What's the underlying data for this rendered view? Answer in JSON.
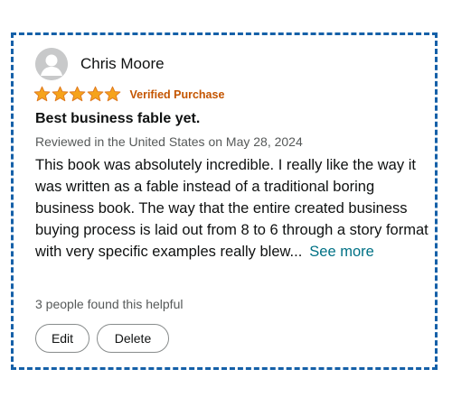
{
  "review": {
    "reviewer_name": "Chris Moore",
    "rating": 5,
    "rating_max": 5,
    "verified_label": "Verified Purchase",
    "title": "Best business fable yet.",
    "meta": "Reviewed in the United States on May 28, 2024",
    "body": "This book was absolutely incredible. I really like the way it was written as a fable instead of a traditional boring business book. The way that the entire created business buying process is laid out from 8 to 6 through a story format with very specific examples really blew...",
    "see_more_label": "See more",
    "helpful_text": "3 people found this helpful",
    "edit_label": "Edit",
    "delete_label": "Delete"
  },
  "icons": {
    "avatar": "user-avatar-icon",
    "star": "star-icon"
  },
  "colors": {
    "border": "#1560a8",
    "star": "#f6a31b",
    "verified": "#c45500",
    "link": "#007185",
    "muted": "#565959",
    "text": "#0f1111"
  }
}
